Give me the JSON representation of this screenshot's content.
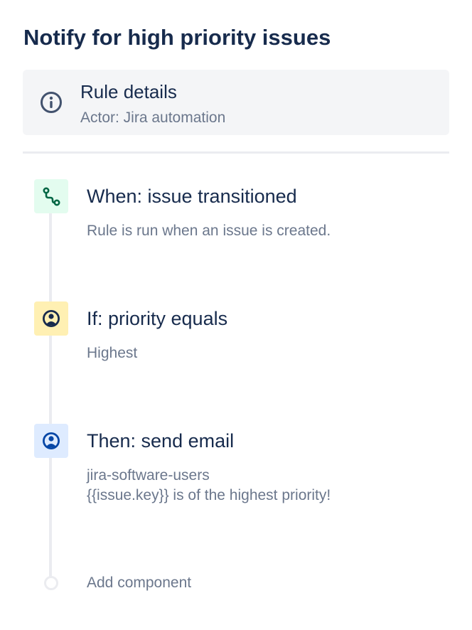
{
  "rule": {
    "title": "Notify for high priority issues"
  },
  "rule_details": {
    "title": "Rule details",
    "actor": "Actor: Jira automation",
    "icon": "info-icon"
  },
  "components": [
    {
      "title": "When: issue transitioned",
      "description": "Rule is run when an issue is created.",
      "icon": "branch-icon",
      "color": "#E3FCEF",
      "icon_color": "#006644"
    },
    {
      "title": "If: priority equals",
      "description": "Highest",
      "icon": "user-circle-icon",
      "color": "#FFF0B3",
      "icon_color": "#172B4D"
    },
    {
      "title": "Then: send email",
      "description_lines": [
        "jira-software-users",
        "{{issue.key}} is of the highest priority!"
      ],
      "icon": "user-circle-icon",
      "color": "#DEEBFF",
      "icon_color": "#0747A6"
    }
  ],
  "add_component": {
    "label": "Add component"
  },
  "colors": {
    "text_primary": "#172B4D",
    "text_secondary": "#6B778C",
    "panel_bg": "#F4F5F7",
    "divider": "#EBECF0"
  }
}
